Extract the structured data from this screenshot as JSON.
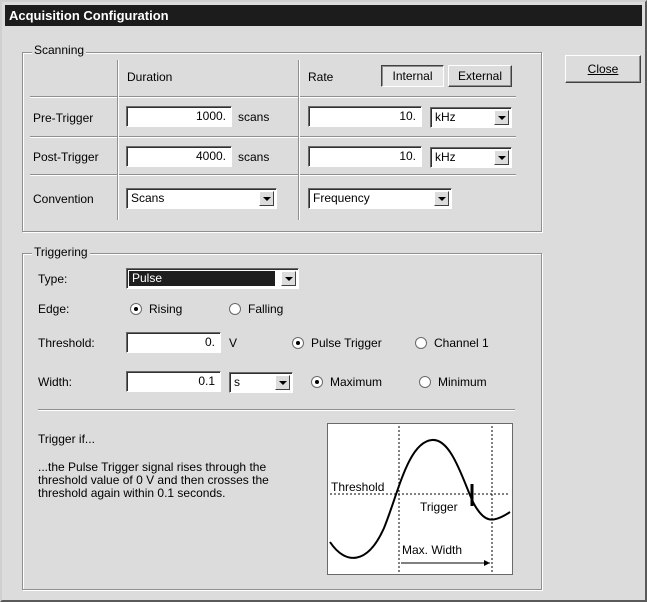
{
  "window": {
    "title": "Acquisition Configuration"
  },
  "buttons": {
    "close": "Close"
  },
  "scanning": {
    "group_label": "Scanning",
    "col_duration": "Duration",
    "col_rate": "Rate",
    "clock_internal": "Internal",
    "clock_external": "External",
    "clock_selected": "Internal",
    "rows": [
      {
        "label": "Pre-Trigger",
        "duration": "1000.",
        "duration_unit": "scans",
        "rate": "10.",
        "rate_unit": "kHz"
      },
      {
        "label": "Post-Trigger",
        "duration": "4000.",
        "duration_unit": "scans",
        "rate": "10.",
        "rate_unit": "kHz"
      }
    ],
    "convention_label": "Convention",
    "convention_duration": "Scans",
    "convention_rate": "Frequency"
  },
  "triggering": {
    "group_label": "Triggering",
    "type_label": "Type:",
    "type_value": "Pulse",
    "edge_label": "Edge:",
    "edge_rising": "Rising",
    "edge_falling": "Falling",
    "edge_selected": "Rising",
    "threshold_label": "Threshold:",
    "threshold_value": "0.",
    "threshold_unit": "V",
    "source_pulse": "Pulse Trigger",
    "source_channel": "Channel 1",
    "source_selected": "Pulse Trigger",
    "width_label": "Width:",
    "width_value": "0.1",
    "width_unit": "s",
    "width_max": "Maximum",
    "width_min": "Minimum",
    "width_selected": "Maximum",
    "trigger_if": "Trigger if...",
    "description_lines": [
      "...the Pulse Trigger signal rises through the",
      "threshold value of 0 V and then crosses the",
      "threshold again within 0.1 seconds."
    ],
    "diagram": {
      "threshold_label": "Threshold",
      "trigger_label": "Trigger",
      "width_label": "Max. Width"
    }
  }
}
